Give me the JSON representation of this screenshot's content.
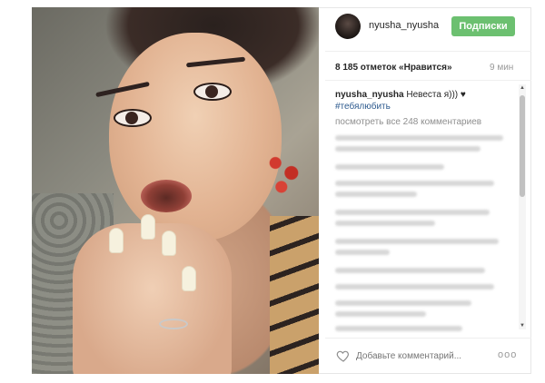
{
  "post": {
    "username": "nyusha_nyusha",
    "follow_label": "Подписки",
    "likes": "8 185 отметок «Нравится»",
    "time": "9 мин"
  },
  "caption": {
    "username": "nyusha_nyusha",
    "text": "Невеста я))) ",
    "heart": "♥",
    "hashtag": "#тебялюбить"
  },
  "comments": {
    "view_all": "посмотреть все 248 комментариев"
  },
  "footer": {
    "comment_placeholder": "Добавьте комментарий...",
    "more": "ooo"
  }
}
